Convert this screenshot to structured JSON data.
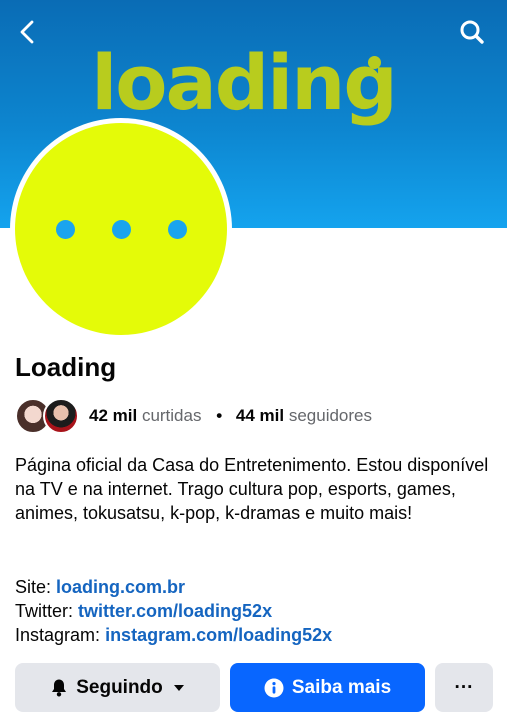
{
  "cover": {
    "logo_text": "loading",
    "background": "#0d85cf",
    "logo_color": "#b8cc1e"
  },
  "nav": {
    "back_icon": "chevron-left-icon",
    "search_icon": "search-icon"
  },
  "profile": {
    "avatar_color": "#e4fb08",
    "avatar_dot_color": "#1aa4ee",
    "name": "Loading"
  },
  "stats": {
    "likes_count": "42 mil",
    "likes_label": "curtidas",
    "separator": "•",
    "followers_count": "44 mil",
    "followers_label": "seguidores"
  },
  "bio": {
    "text": "Página oficial da Casa do Entretenimento. Estou disponível na TV e na internet. Trago cultura pop, esports, games, animes, tokusatsu, k-pop, k-dramas e muito mais!"
  },
  "links": [
    {
      "label": "Site:",
      "value": "loading.com.br"
    },
    {
      "label": "Twitter:",
      "value": "twitter.com/loading52x"
    },
    {
      "label": "Instagram:",
      "value": "instagram.com/loading52x"
    }
  ],
  "actions": {
    "following_label": "Seguindo",
    "info_label": "Saiba mais",
    "more_label": "···",
    "accent": "#0866ff"
  }
}
